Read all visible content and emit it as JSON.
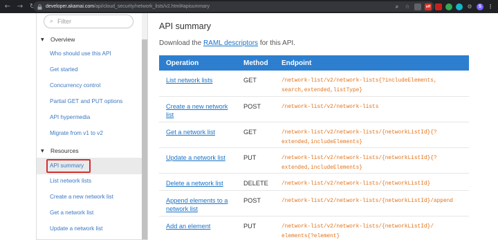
{
  "browser": {
    "url_host": "developer.akamai.com",
    "url_path": "/api/cloud_security/network_lists/v2.html#apisummary",
    "back_icon": "arrow-left-icon",
    "forward_icon": "arrow-right-icon",
    "reload_icon": "reload-icon",
    "profile_initial": "S",
    "ext_badge": "off"
  },
  "sidebar": {
    "filter_placeholder": "Filter",
    "sections": [
      {
        "label": "Overview",
        "items": [
          "Who should use this API",
          "Get started",
          "Concurrency control",
          "Partial GET and PUT options",
          "API hypermedia",
          "Migrate from v1 to v2"
        ]
      },
      {
        "label": "Resources",
        "items": [
          "API summary",
          "List network lists",
          "Create a new network list",
          "Get a network list",
          "Update a network list"
        ]
      }
    ],
    "active_item": "API summary"
  },
  "main": {
    "title": "API summary",
    "download_prefix": "Download the ",
    "download_link": "RAML descriptors",
    "download_suffix": " for this API.",
    "columns": [
      "Operation",
      "Method",
      "Endpoint"
    ],
    "rows": [
      {
        "op": "List network lists",
        "method": "GET",
        "endpoint": "/network-list/v2/network-lists{?includeElements, search,extended,listType}"
      },
      {
        "op": "Create a new network list",
        "method": "POST",
        "endpoint": "/network-list/v2/network-lists"
      },
      {
        "op": "Get a network list",
        "method": "GET",
        "endpoint": "/network-list/v2/network-lists/{networkListId}{? extended,includeElements}"
      },
      {
        "op": "Update a network list",
        "method": "PUT",
        "endpoint": "/network-list/v2/network-lists/{networkListId}{? extended,includeElements}"
      },
      {
        "op": "Delete a network list",
        "method": "DELETE",
        "endpoint": "/network-list/v2/network-lists/{networkListId}"
      },
      {
        "op": "Append elements to a network list",
        "method": "POST",
        "endpoint": "/network-list/v2/network-lists/{networkListId}/append"
      },
      {
        "op": "Add an element",
        "method": "PUT",
        "endpoint": "/network-list/v2/network-lists/{networkListId}/ elements{?element}"
      }
    ]
  },
  "colors": {
    "accent": "#2d7ecf",
    "link": "#1a73c7",
    "endpoint": "#e1731b",
    "highlight_box": "#d32f2f"
  }
}
